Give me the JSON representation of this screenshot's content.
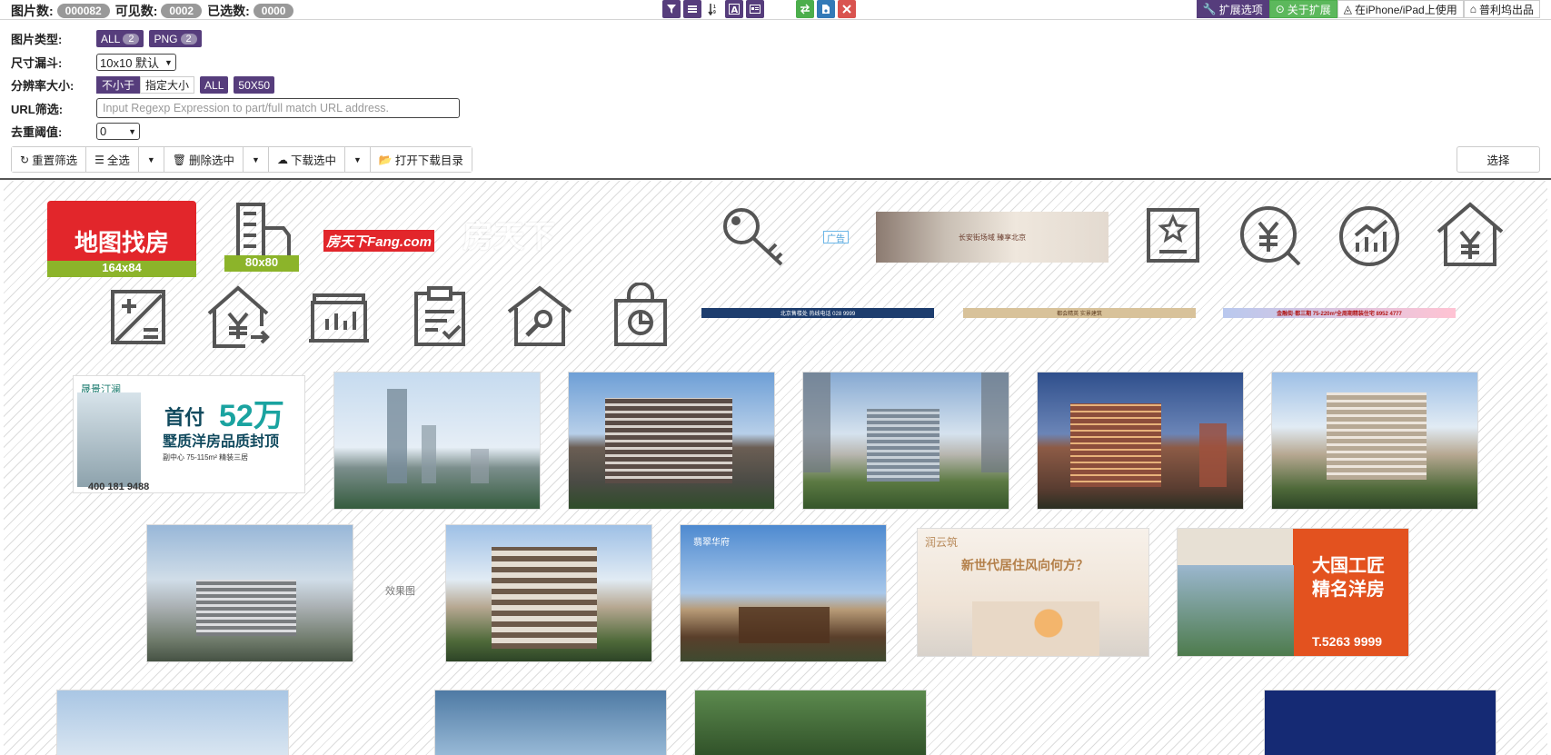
{
  "stats": {
    "images_label": "图片数:",
    "images_value": "000082",
    "visible_label": "可见数:",
    "visible_value": "0002",
    "selected_label": "已选数:",
    "selected_value": "0000"
  },
  "midtools": [
    "filter-icon",
    "list-icon",
    "sort-icon",
    "text-icon",
    "id-card-icon",
    "swap-icon",
    "file-icon",
    "close-icon"
  ],
  "right_buttons": {
    "ext_options": "扩展选项",
    "about": "关于扩展",
    "iphone": "在iPhone/iPad上使用",
    "publisher": "普利坞出品"
  },
  "filters": {
    "type_label": "图片类型:",
    "types": [
      {
        "name": "ALL",
        "count": "2"
      },
      {
        "name": "PNG",
        "count": "2"
      }
    ],
    "size_label": "尺寸漏斗:",
    "size_value": "10x10 默认",
    "res_label": "分辨率大小:",
    "res_mode_on": "不小于",
    "res_mode_off": "指定大小",
    "res_all": "ALL",
    "res_50": "50X50",
    "url_label": "URL筛选:",
    "url_placeholder": "Input Regexp Expression to part/full match URL address.",
    "dedup_label": "去重阈值:",
    "dedup_value": "0"
  },
  "actions": {
    "reset": "重置筛选",
    "select_all": "全选",
    "delete": "删除选中",
    "download": "下载选中",
    "open_dir": "打开下载目录",
    "select": "选择"
  },
  "gallery": {
    "ditu": {
      "text": "地图找房",
      "dims": "164x84"
    },
    "building_dims": "80x80",
    "fang_logo": "房天下Fang.com",
    "ad_tag": "广告",
    "banner1": "长安街场域 臻享北京",
    "banner_a": "北京售楼处 热线电话 028 9999",
    "banner_b": "都会精英 实景建筑",
    "banner_c": "金融街·都三期 75-220m²全周期精装住宅 8952 4777",
    "ad1": {
      "brand": "晟景汀澜",
      "headline1": "首付",
      "headline_num": "52万",
      "headline2": "墅质洋房品质封顶",
      "sub": "副中心 75-115m² 精装三居",
      "phone": "400 181 9488"
    },
    "xiaoguo": "效果图",
    "ad_kingfu": "翡翠华府",
    "ad_cream": {
      "brand": "润云筑",
      "headline": "新世代居住风向何方？"
    },
    "ad_orange": {
      "headline1": "大国工匠",
      "headline2": "精名洋房",
      "phone": "T.5263 9999"
    }
  },
  "colors": {
    "accent": "#563d7c",
    "green": "#5cb85c",
    "red": "#d9534f",
    "fang_red": "#e2262b",
    "dim_green": "#8cb42a"
  }
}
